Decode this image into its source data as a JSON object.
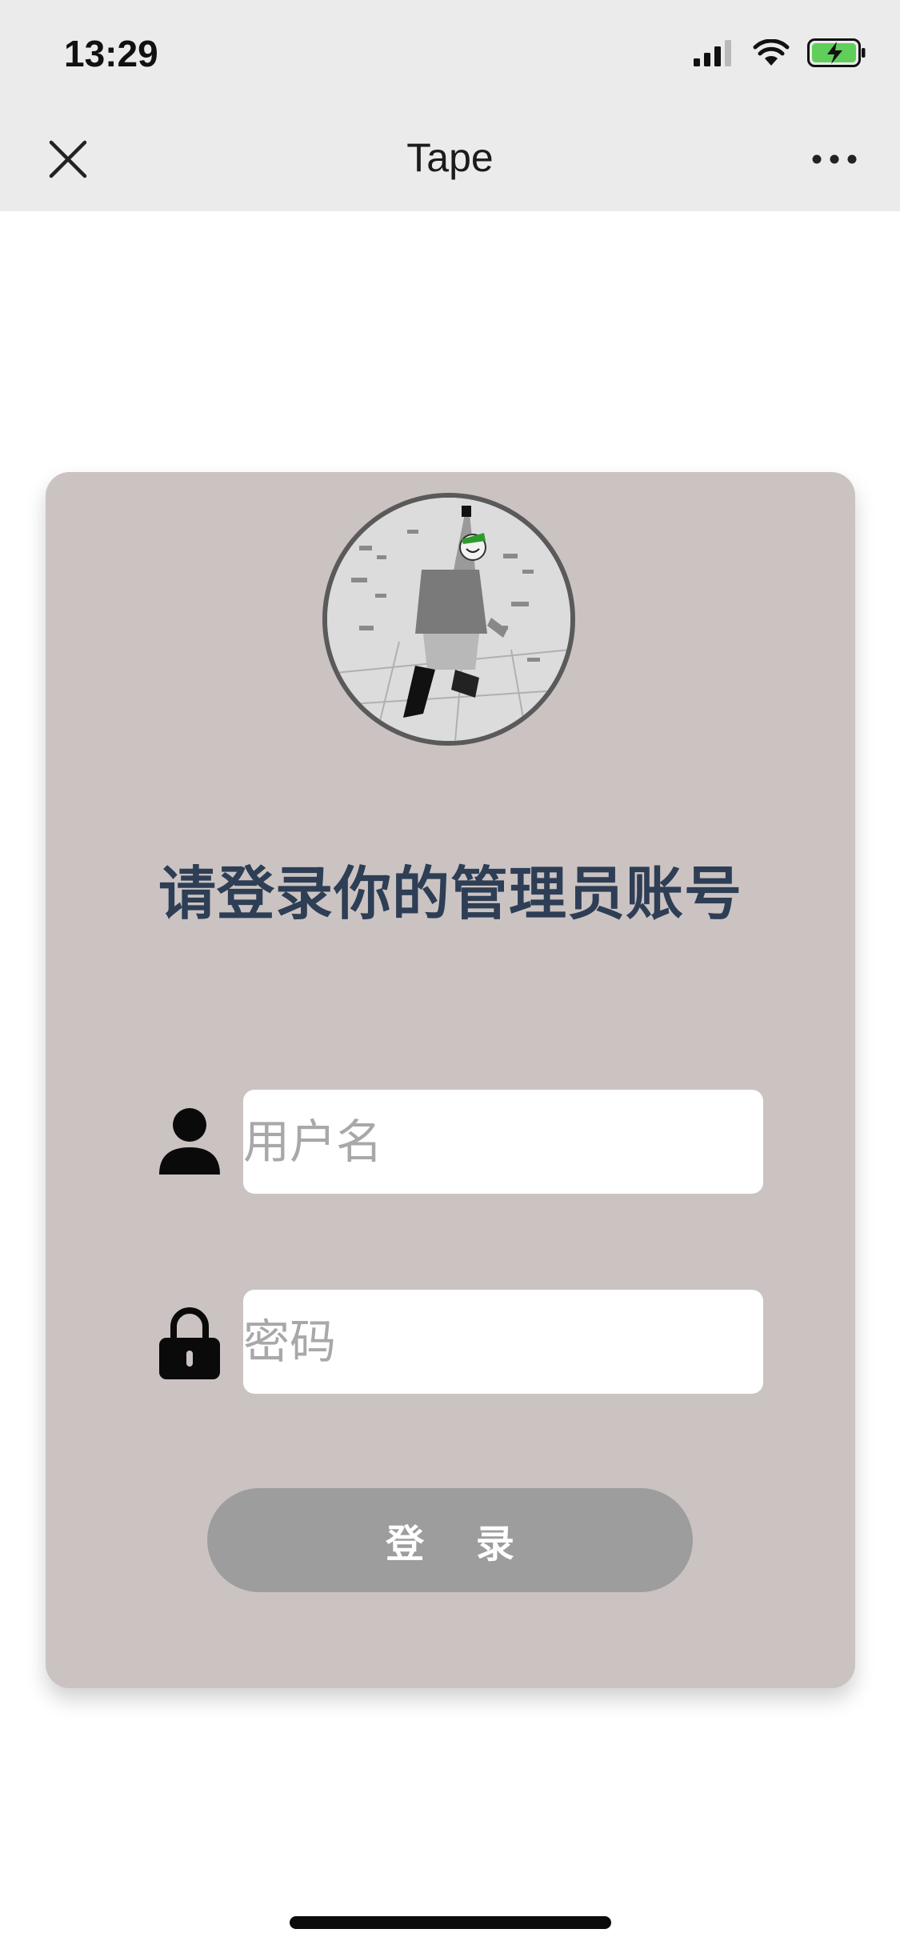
{
  "status_bar": {
    "time": "13:29",
    "icons": [
      "cellular-signal-icon",
      "wifi-icon",
      "battery-charging-icon"
    ],
    "battery_color": "#5fcf5a"
  },
  "nav": {
    "title": "Tape",
    "close_icon": "close-icon",
    "more_icon": "more-icon"
  },
  "login_card": {
    "background": "#cbc3c2",
    "heading": "请登录你的管理员账号",
    "heading_color": "#2d3e55",
    "username": {
      "placeholder": "用户名",
      "value": "",
      "icon": "user-icon"
    },
    "password": {
      "placeholder": "密码",
      "value": "",
      "icon": "lock-icon"
    },
    "login_button": {
      "label": "登 录",
      "color": "#9d9d9d"
    }
  }
}
